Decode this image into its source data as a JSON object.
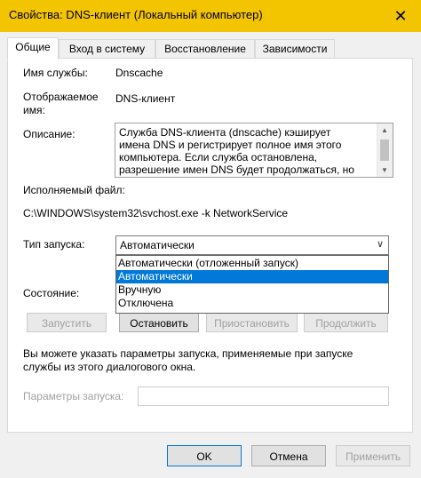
{
  "window": {
    "title": "Свойства: DNS-клиент (Локальный компьютер)",
    "close_glyph": "✕"
  },
  "tabs": [
    {
      "label": "Общие"
    },
    {
      "label": "Вход в систему"
    },
    {
      "label": "Восстановление"
    },
    {
      "label": "Зависимости"
    }
  ],
  "general": {
    "service_name_label": "Имя службы:",
    "service_name_value": "Dnscache",
    "display_name_label_line1": "Отображаемое",
    "display_name_label_line2": "имя:",
    "display_name_value": "DNS-клиент",
    "description_label": "Описание:",
    "description_text": "Служба DNS-клиента (dnscache) кэширует\nимена DNS и регистрирует полное имя этого\nкомпьютера. Если служба остановлена,\nразрешение имен DNS будет продолжаться, но",
    "executable_label": "Исполняемый файл:",
    "executable_value": "C:\\WINDOWS\\system32\\svchost.exe -k NetworkService",
    "startup_type_label": "Тип запуска:",
    "startup_type_value": "Автоматически",
    "startup_options": [
      "Автоматически (отложенный запуск)",
      "Автоматически",
      "Вручную",
      "Отключена"
    ],
    "selected_option_index": 1,
    "status_label": "Состояние:",
    "buttons": {
      "start": "Запустить",
      "stop": "Остановить",
      "pause": "Приостановить",
      "resume": "Продолжить"
    },
    "hint_text_line1": "Вы можете указать параметры запуска, применяемые при запуске",
    "hint_text_line2": "службы из этого диалогового окна.",
    "start_params_label": "Параметры запуска:",
    "start_params_value": ""
  },
  "footer": {
    "ok": "OK",
    "cancel": "Отмена",
    "apply": "Применить"
  },
  "colors": {
    "titlebar": "#f3c400",
    "selection": "#0078d7"
  }
}
